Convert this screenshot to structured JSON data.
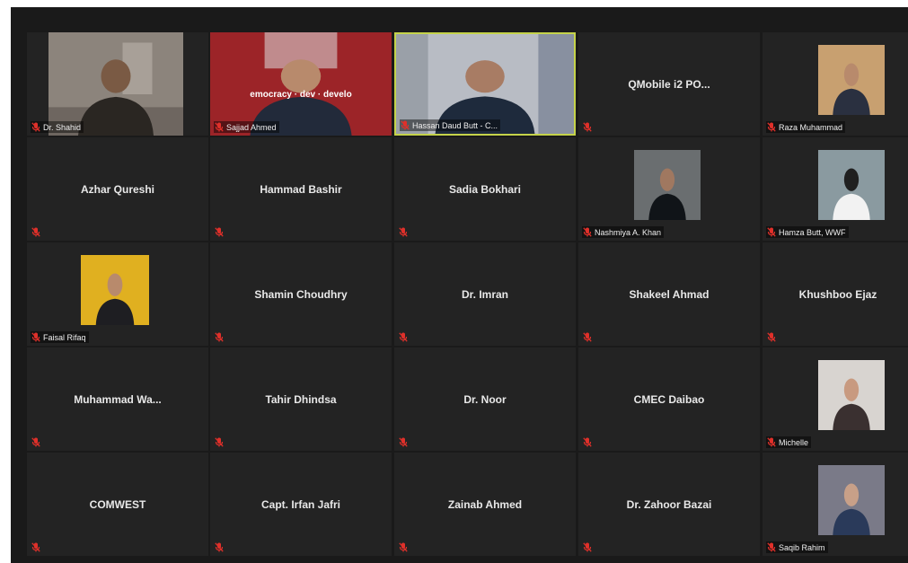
{
  "participants": [
    {
      "name": "Dr. Shahid",
      "show_center": false
    },
    {
      "name": "Sajjad Ahmed",
      "show_center": false,
      "banner": "emocracy · dev · develo"
    },
    {
      "name": "Hassan Daud Butt - C...",
      "show_center": false,
      "active": true
    },
    {
      "name": "QMobile i2  PO...",
      "show_center": true
    },
    {
      "name": "Raza Muhammad",
      "show_center": false
    },
    {
      "name": "Azhar Qureshi",
      "show_center": true
    },
    {
      "name": "Hammad Bashir",
      "show_center": true
    },
    {
      "name": "Sadia Bokhari",
      "show_center": true
    },
    {
      "name": "Nashmiya A. Khan",
      "show_center": false
    },
    {
      "name": "Hamza Butt, WWF",
      "show_center": false
    },
    {
      "name": "Faisal Rifaq",
      "show_center": false
    },
    {
      "name": "Shamin Choudhry",
      "show_center": true
    },
    {
      "name": "Dr. Imran",
      "show_center": true
    },
    {
      "name": "Shakeel Ahmad",
      "show_center": true
    },
    {
      "name": "Khushboo Ejaz",
      "show_center": true
    },
    {
      "name": "Muhammad  Wa...",
      "show_center": true
    },
    {
      "name": "Tahir Dhindsa",
      "show_center": true
    },
    {
      "name": "Dr. Noor",
      "show_center": true
    },
    {
      "name": "CMEC Daibao",
      "show_center": true
    },
    {
      "name": "Michelle",
      "show_center": false
    },
    {
      "name": "COMWEST",
      "show_center": true
    },
    {
      "name": "Capt. Irfan Jafri",
      "show_center": true
    },
    {
      "name": "Zainab Ahmed",
      "show_center": true
    },
    {
      "name": "Dr. Zahoor Bazai",
      "show_center": true
    },
    {
      "name": "Saqib Rahim",
      "show_center": false
    }
  ],
  "colors": {
    "muted_mic": "#e0302a",
    "active_speaker_border": "#c5d34a",
    "tile_bg": "#232323",
    "window_bg": "#1a1a1a"
  }
}
